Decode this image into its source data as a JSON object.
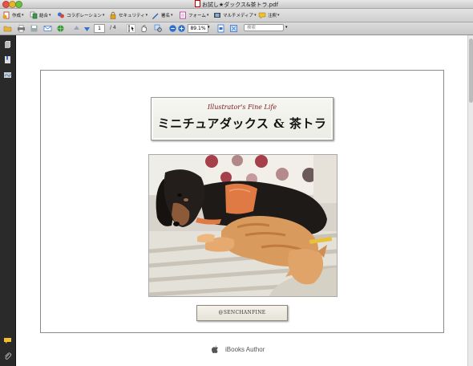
{
  "window": {
    "title": "お試し★ダックス&茶トラ.pdf"
  },
  "toolbar_main": {
    "items": [
      {
        "label": "作成",
        "icon": "create-pdf-icon"
      },
      {
        "label": "結合",
        "icon": "combine-icon"
      },
      {
        "label": "コラボレーション",
        "icon": "collaboration-icon"
      },
      {
        "label": "セキュリティ",
        "icon": "lock-icon"
      },
      {
        "label": "署名",
        "icon": "pen-icon"
      },
      {
        "label": "フォーム",
        "icon": "form-icon"
      },
      {
        "label": "マルチメディア",
        "icon": "film-icon"
      },
      {
        "label": "注釈",
        "icon": "comment-icon"
      }
    ]
  },
  "toolbar_nav": {
    "current_page": "1",
    "total_pages": "/ 4",
    "zoom": "89.1%",
    "search_placeholder": "検索"
  },
  "document": {
    "title_en": "Illustrator's Fine Life",
    "title_ja": "ミニチュアダックス & 茶トラ",
    "handle": "@SENCHANFINE",
    "footer": "iBooks Author"
  },
  "colors": {
    "title_accent": "#7a1a1a",
    "panel_bg": "#2a2a2a"
  }
}
